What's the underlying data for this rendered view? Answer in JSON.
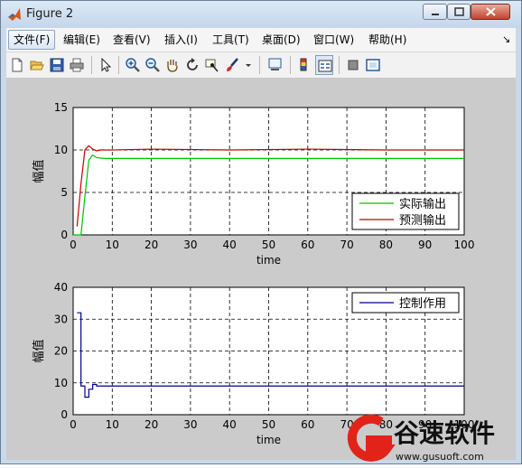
{
  "window": {
    "title": "Figure 2",
    "icon": "matlab-logo-icon",
    "controls": [
      "minimize-icon",
      "maximize-icon",
      "close-icon"
    ]
  },
  "menu": {
    "items": [
      {
        "label": "文件(F)"
      },
      {
        "label": "编辑(E)"
      },
      {
        "label": "查看(V)"
      },
      {
        "label": "插入(I)"
      },
      {
        "label": "工具(T)"
      },
      {
        "label": "桌面(D)"
      },
      {
        "label": "窗口(W)"
      },
      {
        "label": "帮助(H)"
      }
    ],
    "active_index": 0,
    "dock_arrow": "↘"
  },
  "toolbar": {
    "icons": [
      "new-figure-icon",
      "open-file-icon",
      "save-icon",
      "print-icon",
      "edit-plot-arrow-icon",
      "zoom-in-icon",
      "zoom-out-icon",
      "pan-hand-icon",
      "rotate-3d-icon",
      "data-cursor-icon",
      "brush-icon",
      "brush-dropdown-icon",
      "link-plot-icon",
      "insert-colorbar-icon",
      "insert-legend-icon",
      "hide-plot-tools-icon",
      "show-plot-tools-icon"
    ]
  },
  "chart_data": [
    {
      "type": "line",
      "xlabel": "time",
      "ylabel": "幅值",
      "xlim": [
        0,
        100
      ],
      "ylim": [
        0,
        15
      ],
      "xticks": [
        0,
        10,
        20,
        30,
        40,
        50,
        60,
        70,
        80,
        90,
        100
      ],
      "yticks": [
        0,
        5,
        10,
        15
      ],
      "grid": "dashed",
      "legend_position": "bottom-right",
      "series": [
        {
          "name": "实际输出",
          "color": "#00c000",
          "x": [
            0,
            1,
            2,
            3,
            4,
            5,
            6,
            8,
            10,
            100
          ],
          "y": [
            0,
            0,
            0,
            4.5,
            8.8,
            9.4,
            9.1,
            9.0,
            9.0,
            9.0
          ]
        },
        {
          "name": "预测输出",
          "color": "#c00000",
          "x": [
            1,
            2,
            3,
            4,
            5,
            6,
            7,
            10,
            20,
            40,
            60,
            80,
            100
          ],
          "y": [
            1.0,
            6.0,
            10.0,
            10.5,
            10.1,
            9.9,
            10.0,
            10.0,
            10.1,
            10.0,
            10.1,
            10.0,
            10.0
          ]
        }
      ]
    },
    {
      "type": "line",
      "xlabel": "time",
      "ylabel": "幅值",
      "xlim": [
        0,
        100
      ],
      "ylim": [
        0,
        40
      ],
      "xticks": [
        0,
        10,
        20,
        30,
        40,
        50,
        60,
        70,
        80,
        90,
        100
      ],
      "yticks": [
        0,
        10,
        20,
        30,
        40
      ],
      "grid": "dashed",
      "legend_position": "top-right",
      "series": [
        {
          "name": "控制作用",
          "color": "#00008b",
          "step": true,
          "x": [
            1,
            2,
            3,
            4,
            5,
            6,
            100
          ],
          "y": [
            32,
            9,
            5.5,
            8,
            9.5,
            9,
            9
          ]
        }
      ]
    }
  ],
  "watermark": {
    "brand": "谷速软件",
    "url": "www.gusuoft.com"
  }
}
